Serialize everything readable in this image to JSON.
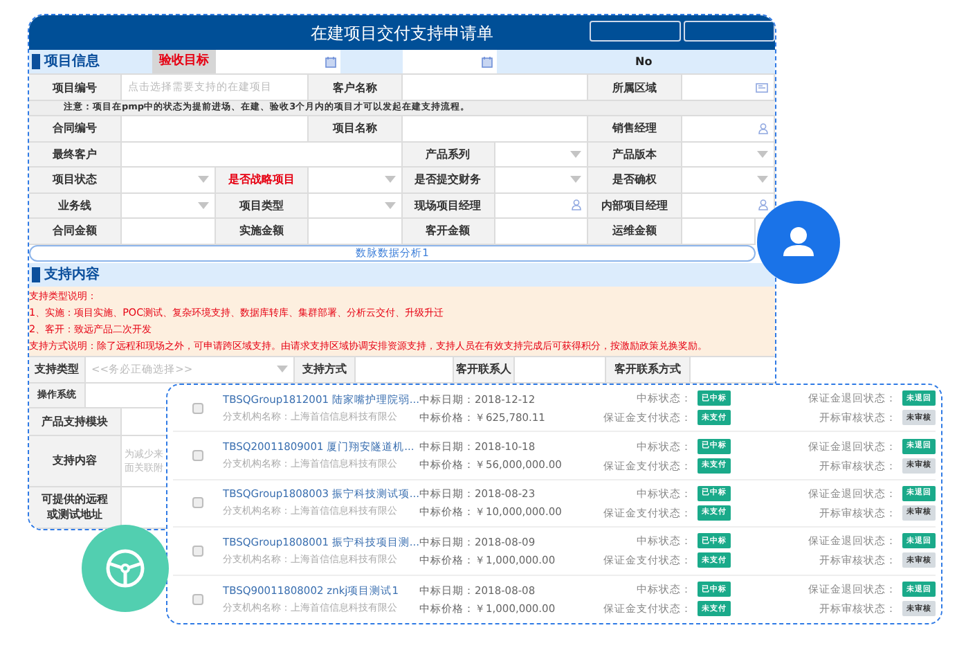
{
  "header": {
    "title": "在建项目交付支持申请单",
    "buttons": [
      {
        "kind": "outline"
      },
      {
        "kind": "outline"
      }
    ]
  },
  "project_section": {
    "title": "项目信息",
    "target_label": "验收目标",
    "target_fields": [
      {
        "kind": "date"
      },
      {
        "kind": "date"
      }
    ],
    "target_value": "No"
  },
  "project_rows": [
    {
      "cells": [
        {
          "kind": "label",
          "text": "项目编号",
          "emphasis": false
        },
        {
          "kind": "text",
          "placeholder": "点击选择需要支持的在建项目"
        },
        {
          "kind": "label",
          "text": "客户名称",
          "emphasis": false
        },
        {
          "kind": "text"
        },
        {
          "kind": "label",
          "text": "所属区域",
          "emphasis": false
        },
        {
          "kind": "region"
        }
      ]
    },
    {
      "cells": [
        {
          "kind": "label",
          "text": "合同编号",
          "emphasis": false
        },
        {
          "kind": "text"
        },
        {
          "kind": "label",
          "text": "项目名称",
          "emphasis": false
        },
        {
          "kind": "text"
        },
        {
          "kind": "label",
          "text": "销售经理",
          "emphasis": false
        },
        {
          "kind": "person"
        }
      ]
    },
    {
      "cells": [
        {
          "kind": "label",
          "text": "最终客户",
          "emphasis": false
        },
        {
          "kind": "text"
        },
        {
          "kind": "label",
          "text": "产品系列",
          "emphasis": false
        },
        {
          "kind": "select"
        },
        {
          "kind": "label",
          "text": "产品版本",
          "emphasis": false
        },
        {
          "kind": "select"
        }
      ]
    },
    {
      "cells": [
        {
          "kind": "label",
          "text": "项目状态",
          "emphasis": false
        },
        {
          "kind": "select"
        },
        {
          "kind": "label",
          "text": "是否战略项目",
          "emphasis": true
        },
        {
          "kind": "select"
        },
        {
          "kind": "label",
          "text": "是否提交财务",
          "emphasis": false
        },
        {
          "kind": "select"
        },
        {
          "kind": "label",
          "text": "是否确权",
          "emphasis": false
        },
        {
          "kind": "select"
        }
      ]
    },
    {
      "cells": [
        {
          "kind": "label",
          "text": "业务线",
          "emphasis": false
        },
        {
          "kind": "select"
        },
        {
          "kind": "label",
          "text": "项目类型",
          "emphasis": false
        },
        {
          "kind": "select"
        },
        {
          "kind": "label",
          "text": "现场项目经理",
          "emphasis": false
        },
        {
          "kind": "person"
        },
        {
          "kind": "label",
          "text": "内部项目经理",
          "emphasis": false
        },
        {
          "kind": "person"
        }
      ]
    },
    {
      "cells": [
        {
          "kind": "label",
          "text": "合同金额",
          "emphasis": false
        },
        {
          "kind": "text"
        },
        {
          "kind": "label",
          "text": "实施金额",
          "emphasis": false
        },
        {
          "kind": "text"
        },
        {
          "kind": "label",
          "text": "客开金额",
          "emphasis": false
        },
        {
          "kind": "text"
        },
        {
          "kind": "label",
          "text": "运维金额",
          "emphasis": false
        },
        {
          "kind": "text"
        }
      ]
    }
  ],
  "project_note": "注意：项目在pmp中的状态为提前进场、在建、验收3个月内的项目才可以发起在建支持流程。",
  "analysis_button": "数脉数据分析1",
  "support_section": {
    "title": "支持内容"
  },
  "support_notes": [
    "支持类型说明：",
    "1、实施：项目实施、POC测试、复杂环境支持、数据库转库、集群部署、分析云交付、升级升迁",
    "2、客开：致远产品二次开发",
    "支持方式说明：除了远程和现场之外，可申请跨区域支持。由请求支持区域协调安排资源支持，支持人员在有效支持完成后可获得积分，按激励政策兑换奖励。"
  ],
  "support_row": {
    "cells": [
      {
        "kind": "label",
        "text": "支持类型",
        "emphasis": false
      },
      {
        "kind": "select",
        "placeholder": "<<务必正确选择>>"
      },
      {
        "kind": "label",
        "text": "支持方式",
        "emphasis": false
      },
      {
        "kind": "text"
      },
      {
        "kind": "label",
        "text": "客开联系人",
        "emphasis": false
      },
      {
        "kind": "text"
      },
      {
        "kind": "label",
        "text": "客开联系方式",
        "emphasis": false
      },
      {
        "kind": "text"
      }
    ]
  },
  "support_fields": [
    {
      "label": "操作系统",
      "kind": "short"
    },
    {
      "label": "产品支持模块",
      "kind": "wide"
    },
    {
      "label": "支持内容",
      "kind": "wide",
      "placeholder_lines": [
        "为减少来",
        "面关联附"
      ]
    },
    {
      "label": "可提供的远程或测试地址",
      "kind": "wide"
    }
  ],
  "bid_list": [
    {
      "checked": false,
      "title": "TBSQGroup1812001 陆家嘴护理院弱...",
      "branch": "分支机构名称：上海首信信息科技有限公",
      "date_label": "中标日期：",
      "date": "2018-12-12",
      "price_label": "中标价格：",
      "price": "￥625,780.11",
      "statuses": [
        {
          "label": "中标状态：",
          "value": "已中标",
          "color": "#1aaa8a"
        },
        {
          "label": "保证金支付状态：",
          "value": "未支付",
          "color": "#1aaa8a"
        },
        {
          "label": "保证金退回状态：",
          "value": "未退回",
          "color": "#1aaa8a"
        },
        {
          "label": "开标审核状态：",
          "value": "未审核",
          "color": "#d5dbe0"
        }
      ]
    },
    {
      "checked": false,
      "title": "TBSQ20011809001 厦门翔安隧道机...",
      "branch": "分支机构名称：上海首信信息科技有限公",
      "date_label": "中标日期：",
      "date": "2018-10-18",
      "price_label": "中标价格：",
      "price": "￥56,000,000.00",
      "statuses": [
        {
          "label": "中标状态：",
          "value": "已中标",
          "color": "#1aaa8a"
        },
        {
          "label": "保证金支付状态：",
          "value": "未支付",
          "color": "#1aaa8a"
        },
        {
          "label": "保证金退回状态：",
          "value": "未退回",
          "color": "#1aaa8a"
        },
        {
          "label": "开标审核状态：",
          "value": "未审核",
          "color": "#d5dbe0"
        }
      ]
    },
    {
      "checked": false,
      "title": "TBSQGroup1808003 振宁科技测试项...",
      "branch": "分支机构名称：上海首信信息科技有限公",
      "date_label": "中标日期：",
      "date": "2018-08-23",
      "price_label": "中标价格：",
      "price": "￥10,000,000.00",
      "statuses": [
        {
          "label": "中标状态：",
          "value": "已中标",
          "color": "#1aaa8a"
        },
        {
          "label": "保证金支付状态：",
          "value": "未支付",
          "color": "#1aaa8a"
        },
        {
          "label": "保证金退回状态：",
          "value": "未退回",
          "color": "#1aaa8a"
        },
        {
          "label": "开标审核状态：",
          "value": "未审核",
          "color": "#d5dbe0"
        }
      ]
    },
    {
      "checked": false,
      "title": "TBSQGroup1808001 振宁科技项目测...",
      "branch": "分支机构名称：上海首信信息科技有限公",
      "date_label": "中标日期：",
      "date": "2018-08-09",
      "price_label": "中标价格：",
      "price": "￥1,000,000.00",
      "statuses": [
        {
          "label": "中标状态：",
          "value": "已中标",
          "color": "#1aaa8a"
        },
        {
          "label": "保证金支付状态：",
          "value": "未支付",
          "color": "#1aaa8a"
        },
        {
          "label": "保证金退回状态：",
          "value": "未退回",
          "color": "#1aaa8a"
        },
        {
          "label": "开标审核状态：",
          "value": "未审核",
          "color": "#d5dbe0"
        }
      ]
    },
    {
      "checked": false,
      "title": "TBSQ90011808002 znkj项目测试1",
      "branch": "分支机构名称：上海首信信息科技有限公",
      "date_label": "中标日期：",
      "date": "2018-08-08",
      "price_label": "中标价格：",
      "price": "￥1,000,000.00",
      "statuses": [
        {
          "label": "中标状态：",
          "value": "已中标",
          "color": "#1aaa8a"
        },
        {
          "label": "保证金支付状态：",
          "value": "未支付",
          "color": "#1aaa8a"
        },
        {
          "label": "保证金退回状态：",
          "value": "未退回",
          "color": "#1aaa8a"
        },
        {
          "label": "开标审核状态：",
          "value": "未审核",
          "color": "#d5dbe0"
        }
      ]
    }
  ],
  "badges": [
    {
      "kind": "user",
      "color": "#1a73e8"
    },
    {
      "kind": "steering",
      "color": "#52cfb0"
    }
  ]
}
